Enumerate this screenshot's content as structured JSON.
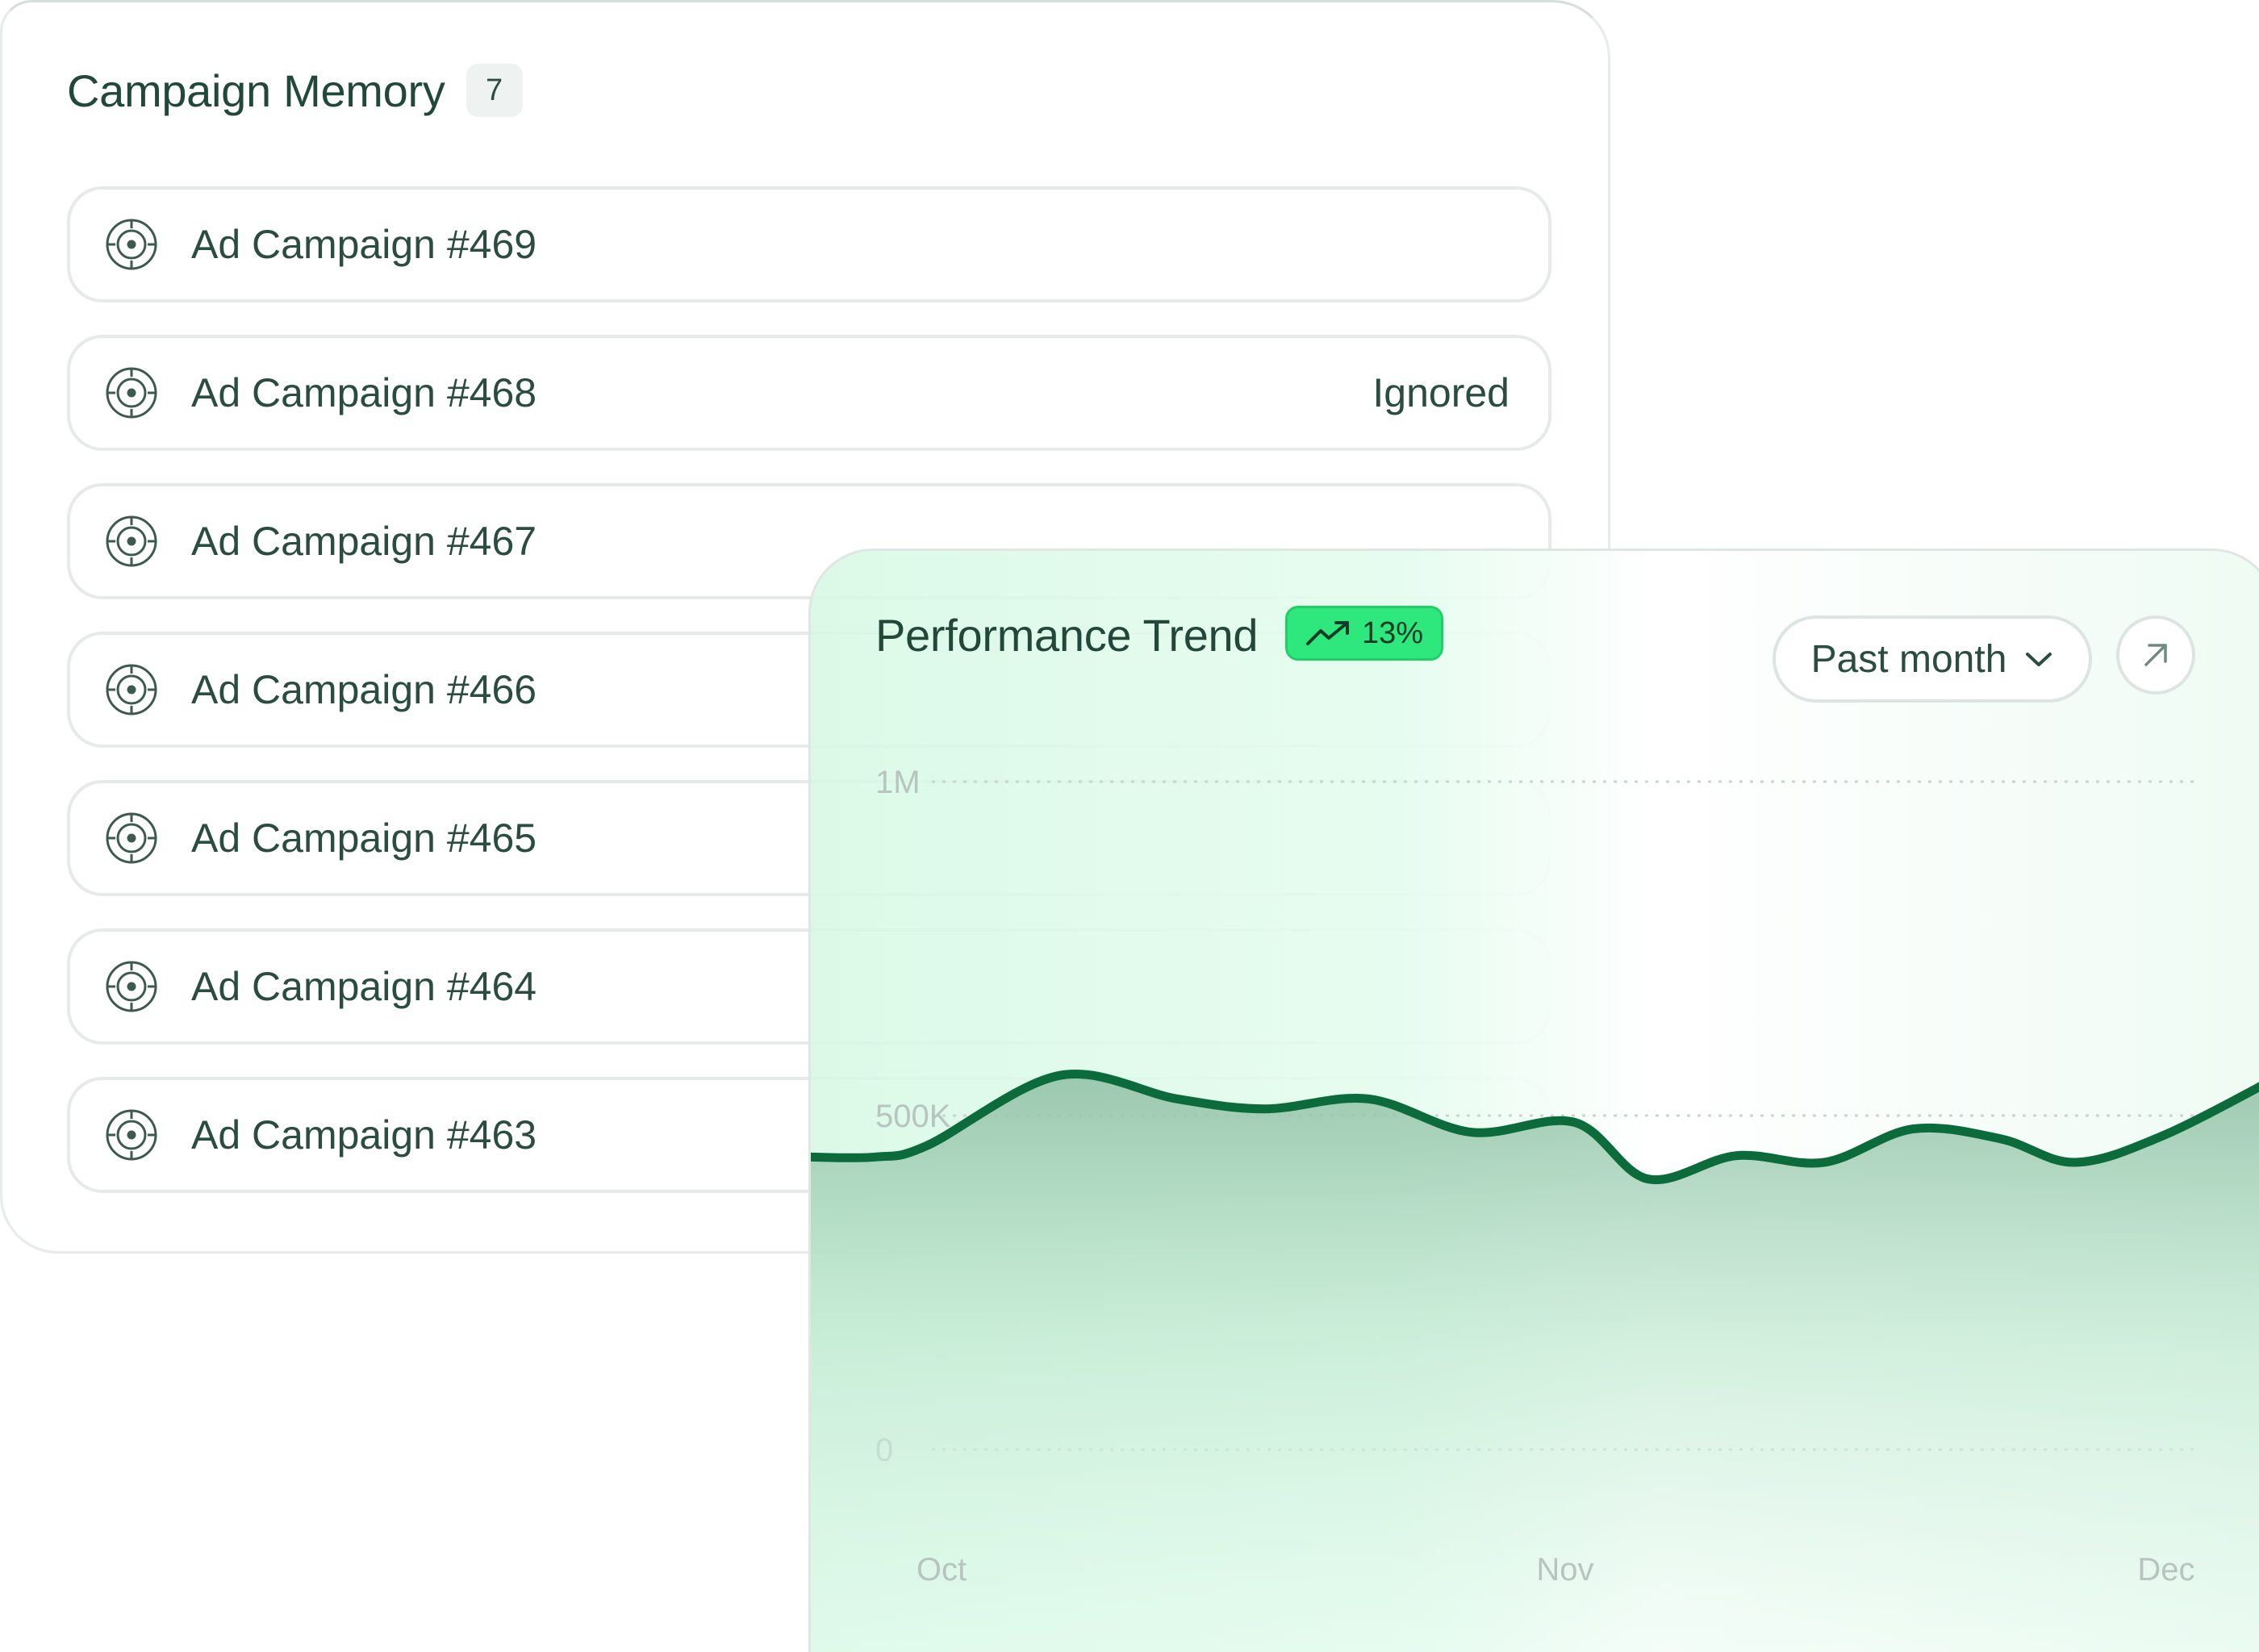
{
  "memory": {
    "title": "Campaign Memory",
    "count": "7",
    "items": [
      {
        "name": "Ad Campaign #469",
        "status": ""
      },
      {
        "name": "Ad Campaign #468",
        "status": "Ignored"
      },
      {
        "name": "Ad Campaign #467",
        "status": ""
      },
      {
        "name": "Ad Campaign #466",
        "status": ""
      },
      {
        "name": "Ad Campaign #465",
        "status": ""
      },
      {
        "name": "Ad Campaign #464",
        "status": ""
      },
      {
        "name": "Ad Campaign #463",
        "status": ""
      }
    ]
  },
  "trend": {
    "title": "Performance Trend",
    "change": "13%",
    "period": "Past month",
    "icons": {
      "badge": "trending-up-icon",
      "select": "chevron-down-icon",
      "expand": "arrow-up-right-icon",
      "row": "target-icon"
    }
  },
  "colors": {
    "line": "#0b6b3a",
    "accent": "#2ee87d",
    "text": "#22473b"
  },
  "chart_data": {
    "type": "area",
    "x": [
      0.0,
      0.045,
      0.08,
      0.17,
      0.25,
      0.31,
      0.38,
      0.45,
      0.52,
      0.57,
      0.63,
      0.69,
      0.75,
      0.81,
      0.86,
      0.92,
      1.0
    ],
    "values": [
      438000,
      438000,
      455000,
      560000,
      525000,
      510000,
      525000,
      475000,
      490000,
      405000,
      440000,
      430000,
      480000,
      465000,
      430000,
      470000,
      560000
    ],
    "x_ticks": [
      "Oct",
      "Nov",
      "Dec"
    ],
    "y_ticks": [
      "1M",
      "500K",
      "0"
    ],
    "ylim": [
      0,
      1000000
    ],
    "grid": true
  }
}
